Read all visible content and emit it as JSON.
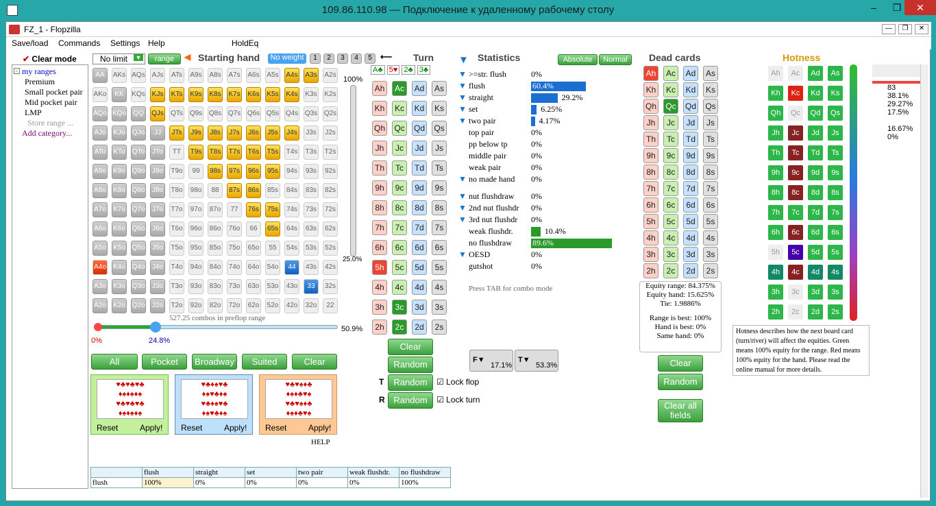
{
  "window_title": "109.86.110.98 — Подключение к удаленному рабочему столу",
  "app_title": "FZ_1 - Flopzilla",
  "menu": [
    "Save/load",
    "Commands",
    "Settings",
    "Help",
    "HoldEq"
  ],
  "sidebar": {
    "clear_mode": "Clear mode",
    "root": "my ranges",
    "items": [
      "Premium",
      "Small pocket pair",
      "Mid pocket pair",
      "LMP"
    ],
    "store": "Store range ...",
    "add": "Add category..."
  },
  "range": {
    "select": "No limit",
    "range_btn": "range",
    "title": "Starting hand",
    "no_weight": "No weight",
    "weights": [
      "1",
      "2",
      "3",
      "4",
      "5"
    ],
    "pct_top": "100%",
    "pct_bottom": "25.0%",
    "combos": "527.25 combos in preflop range",
    "slider_left": "0%",
    "slider_mid": "24.8%",
    "slider_pct": "50.9%"
  },
  "buttons": {
    "all": "All",
    "pocket": "Pocket",
    "broadway": "Broadway",
    "suited": "Suited",
    "clear": "Clear",
    "reset": "Reset",
    "apply": "Apply!",
    "help": "HELP"
  },
  "turn": {
    "title": "Turn",
    "clear": "Clear",
    "random": "Random",
    "lock_flop": "Lock flop",
    "lock_turn": "Lock turn",
    "t_label": "T",
    "r_label": "R"
  },
  "stats": {
    "title": "Statistics",
    "absolute": "Absolute",
    "normal": "Normal",
    "press_tab": "Press TAB for combo mode",
    "f_value": "17.1%",
    "t_value": "53.3%",
    "rows": [
      {
        "label": ">=str. flush",
        "value": "0%"
      },
      {
        "label": "flush",
        "value": "60.4%"
      },
      {
        "label": "straight",
        "value": "29.2%"
      },
      {
        "label": "set",
        "value": "6.25%"
      },
      {
        "label": "two pair",
        "value": "4.17%"
      },
      {
        "label": "top pair",
        "value": "0%"
      },
      {
        "label": "pp below tp",
        "value": "0%"
      },
      {
        "label": "middle pair",
        "value": "0%"
      },
      {
        "label": "weak pair",
        "value": "0%"
      },
      {
        "label": "no made hand",
        "value": "0%"
      },
      {
        "label": "nut flushdraw",
        "value": "0%"
      },
      {
        "label": "2nd nut flushdr",
        "value": "0%"
      },
      {
        "label": "3rd nut flushdr",
        "value": "0%"
      },
      {
        "label": "weak flushdr.",
        "value": "10.4%"
      },
      {
        "label": "no flushdraw",
        "value": "89.6%"
      },
      {
        "label": "OESD",
        "value": "0%"
      },
      {
        "label": "gutshot",
        "value": "0%"
      }
    ]
  },
  "dead": {
    "title": "Dead cards",
    "clear": "Clear",
    "random": "Random",
    "clear_all": "Clear all fields",
    "equity_range": "Equity range: 84.375%",
    "equity_hand": "Equity hand: 15.625%",
    "tie": "Tie: 1.9886%",
    "range_best": "Range is best: 100%",
    "hand_best": "Hand is best: 0%",
    "same_hand": "Same hand: 0%"
  },
  "hotness": {
    "title": "Hotness",
    "desc": "Hotness describes how the next board card (turn/river) will affect the equities. Green means 100% equity for the range. Red means 100% equity for the hand. Please read the online manual for more details."
  },
  "right_stats": [
    "83",
    "38.1%",
    "29.27%",
    "17.5%",
    "",
    "16.67%",
    "0%"
  ],
  "bottom_table": {
    "headers": [
      "flush",
      "straight",
      "set",
      "two pair",
      "weak flushdr.",
      "no flushdraw"
    ],
    "row_label": "flush",
    "values": [
      "100%",
      "0%",
      "0%",
      "0%",
      "0%",
      "100%"
    ]
  }
}
